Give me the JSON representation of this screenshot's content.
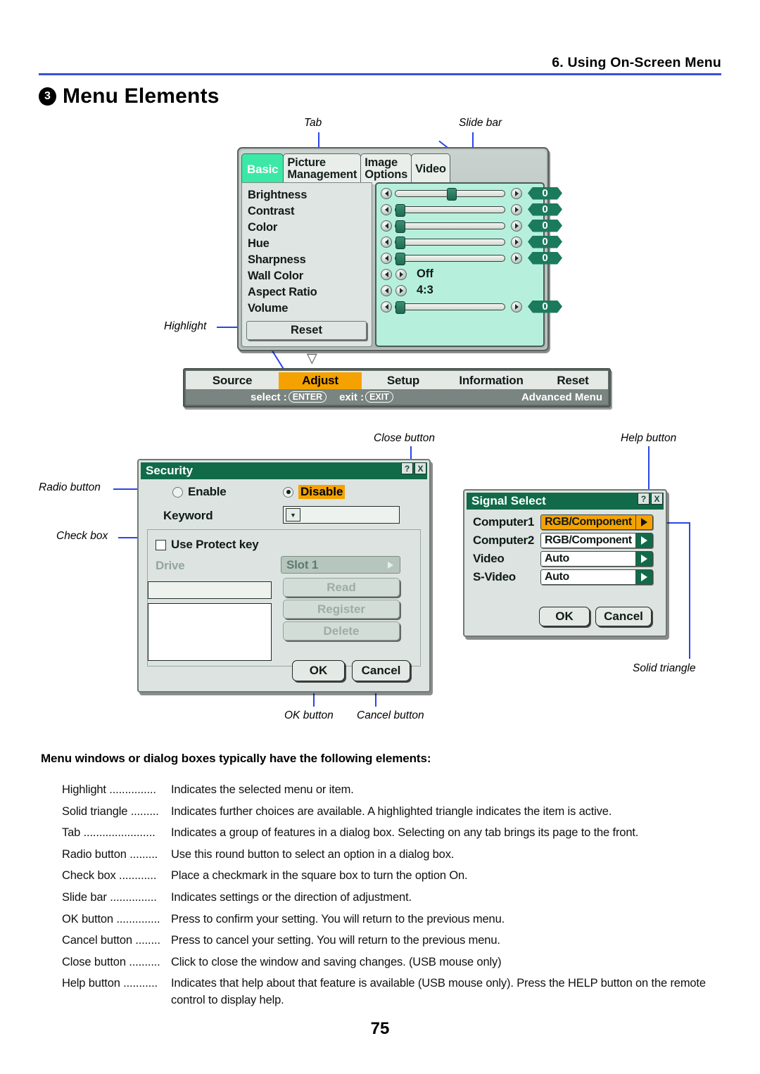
{
  "page": {
    "header_title": "6. Using On-Screen Menu",
    "section_number": "3",
    "section_title": "Menu Elements",
    "page_number": "75"
  },
  "callouts": {
    "tab": "Tab",
    "slide_bar": "Slide bar",
    "highlight": "Highlight",
    "close_button": "Close button",
    "help_button": "Help button",
    "radio_button": "Radio button",
    "check_box": "Check box",
    "ok_button": "OK button",
    "cancel_button": "Cancel button",
    "solid_triangle": "Solid triangle"
  },
  "osd_menu": {
    "tabs": [
      {
        "label": "Basic",
        "lines": [
          "Basic"
        ],
        "selected": true
      },
      {
        "label": "Picture Management",
        "lines": [
          "Picture",
          "Management"
        ],
        "selected": false
      },
      {
        "label": "Image Options",
        "lines": [
          "Image",
          "Options"
        ],
        "selected": false
      },
      {
        "label": "Video",
        "lines": [
          "Video"
        ],
        "selected": false
      }
    ],
    "rows": [
      {
        "label": "Brightness",
        "type": "slider",
        "value": "0",
        "knob_pct": 47
      },
      {
        "label": "Contrast",
        "type": "slider",
        "value": "0",
        "knob_pct": 1
      },
      {
        "label": "Color",
        "type": "slider",
        "value": "0",
        "knob_pct": 1
      },
      {
        "label": "Hue",
        "type": "slider",
        "value": "0",
        "knob_pct": 1
      },
      {
        "label": "Sharpness",
        "type": "slider",
        "value": "0",
        "knob_pct": 1
      },
      {
        "label": "Wall Color",
        "type": "choice",
        "value": "Off"
      },
      {
        "label": "Aspect Ratio",
        "type": "choice",
        "value": "4:3"
      },
      {
        "label": "Volume",
        "type": "slider",
        "value": "0",
        "knob_pct": 1
      }
    ],
    "reset_label": "Reset"
  },
  "menu_bar": {
    "items": [
      {
        "label": "Source",
        "selected": false
      },
      {
        "label": "Adjust",
        "selected": true
      },
      {
        "label": "Setup",
        "selected": false
      },
      {
        "label": "Information",
        "selected": false
      },
      {
        "label": "Reset",
        "selected": false
      }
    ],
    "hint_select_label": "select :",
    "hint_select_key": "ENTER",
    "hint_exit_label": "exit :",
    "hint_exit_key": "EXIT",
    "advanced_label": "Advanced Menu"
  },
  "security_dialog": {
    "title": "Security",
    "help_btn": "?",
    "close_btn": "X",
    "enable_label": "Enable",
    "disable_label": "Disable",
    "keyword_label": "Keyword",
    "keyword_value": "",
    "use_protect_key_label": "Use Protect key",
    "drive_label": "Drive",
    "drive_value": "Slot 1",
    "path_value": "",
    "list_value": "",
    "read_label": "Read",
    "register_label": "Register",
    "delete_label": "Delete",
    "ok_label": "OK",
    "cancel_label": "Cancel"
  },
  "signal_dialog": {
    "title": "Signal Select",
    "help_btn": "?",
    "close_btn": "X",
    "rows": [
      {
        "label": "Computer1",
        "value": "RGB/Component",
        "highlighted": true
      },
      {
        "label": "Computer2",
        "value": "RGB/Component",
        "highlighted": false
      },
      {
        "label": "Video",
        "value": "Auto",
        "highlighted": false
      },
      {
        "label": "S-Video",
        "value": "Auto",
        "highlighted": false
      }
    ],
    "ok_label": "OK",
    "cancel_label": "Cancel"
  },
  "definitions": {
    "intro": "Menu windows or dialog boxes typically have the following elements:",
    "items": [
      {
        "term": "Highlight ...............",
        "desc": "Indicates the selected menu or item."
      },
      {
        "term": "Solid triangle .........",
        "desc": "Indicates further choices are available. A highlighted triangle indicates the item is active."
      },
      {
        "term": "Tab .......................",
        "desc": "Indicates a group of features in a dialog box. Selecting on any tab brings its page to the front."
      },
      {
        "term": "Radio button .........",
        "desc": "Use this round button to select an option in a dialog box."
      },
      {
        "term": "Check box ............",
        "desc": "Place a checkmark in the square box to turn the option On."
      },
      {
        "term": "Slide bar ...............",
        "desc": "Indicates settings or the direction of adjustment."
      },
      {
        "term": "OK button ..............",
        "desc": "Press to confirm your setting. You will return to the previous menu."
      },
      {
        "term": "Cancel button ........",
        "desc": "Press to cancel your setting. You will return to the previous menu."
      },
      {
        "term": "Close button ..........",
        "desc": "Click to close the window and saving changes. (USB mouse only)"
      },
      {
        "term": "Help button ...........",
        "desc": "Indicates that help about that feature is available (USB mouse only). Press the HELP button on the remote"
      }
    ],
    "help_continuation": "control to display help."
  },
  "colors": {
    "rule": "#3a4fd8",
    "leader": "#2a46e8",
    "highlight_orange": "#f5a200",
    "tab_active_green": "#3ce8a6",
    "title_green": "#116b49",
    "panel_mint": "#b6f0dd"
  }
}
